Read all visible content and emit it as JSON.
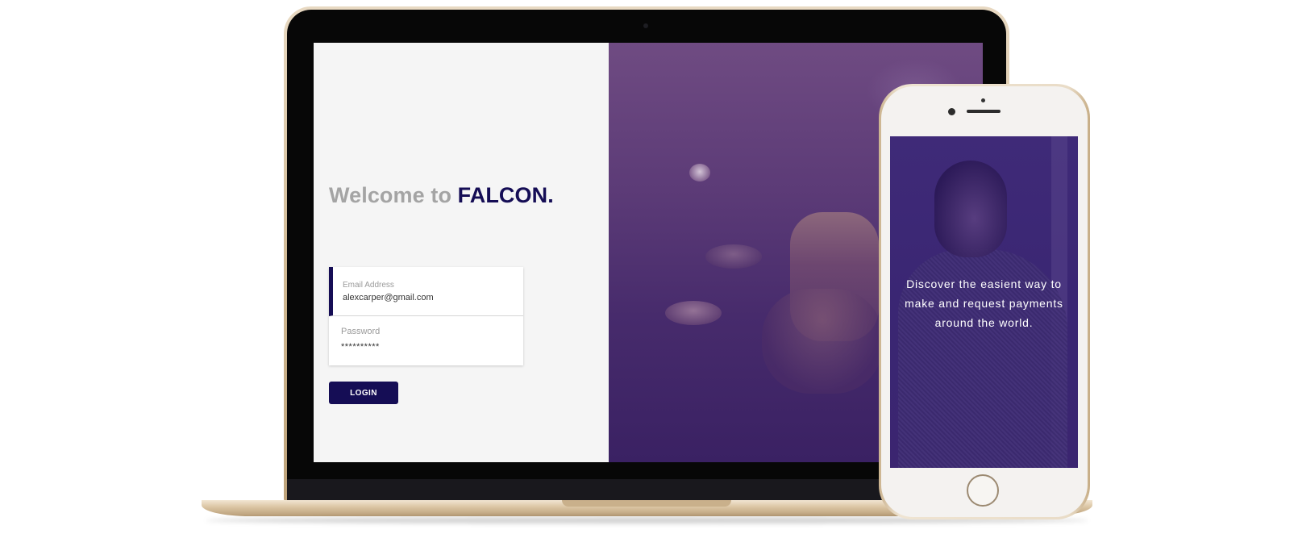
{
  "laptop": {
    "welcome": {
      "prefix": "Welcome to",
      "brand": "FALCON."
    },
    "login_form": {
      "email": {
        "label": "Email Address",
        "value": "alexcarper@gmail.com"
      },
      "password": {
        "label": "Password",
        "value": "**********"
      },
      "login_label": "LOGIN"
    }
  },
  "phone": {
    "tagline_lines": [
      "Discover the easient way to",
      "make and request payments",
      "around the world."
    ]
  },
  "colors": {
    "brand": "#150d55",
    "welcome_gray": "#a4a4a4",
    "photo_tint": "#4a2d6e",
    "device_gold": "#d8c3a0"
  }
}
